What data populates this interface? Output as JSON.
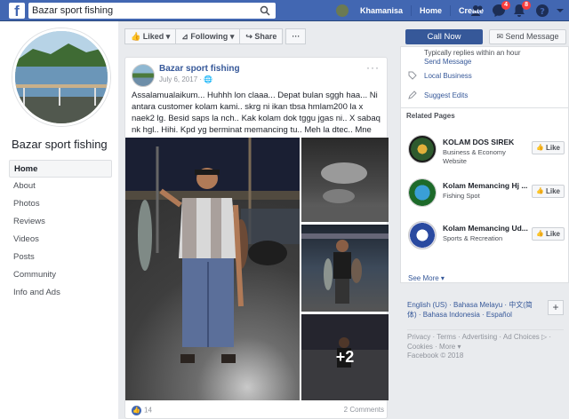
{
  "topbar": {
    "logo": "f",
    "search_value": "Bazar sport fishing",
    "user_name": "Khamanisa",
    "home_label": "Home",
    "create_label": "Create",
    "messages_badge": "4",
    "notifications_badge": "8"
  },
  "left": {
    "page_name": "Bazar sport fishing",
    "nav": [
      "Home",
      "About",
      "Photos",
      "Reviews",
      "Videos",
      "Posts",
      "Community",
      "Info and Ads"
    ]
  },
  "actions": {
    "liked": "Liked",
    "following": "Following",
    "share": "Share",
    "more": "···"
  },
  "post": {
    "page_name": "Bazar sport fishing",
    "date": "July 6, 2017 · 🌐",
    "text": "Assalamualaikum... Huhhh lon claaa... Depat bulan sggh haa... Ni antara customer kolam kami.. skrg ni ikan tbsa hmlam200 la x naek2 lg. Besid saps la nch.. Kak kolam dok tggu jgas ni.. X sabaq nk hgl.. Hihi. Kpd yg berminat memancing tu.. Meh la dtec.. Mne tau.. Ad rezki..",
    "more_photos": "+2",
    "likes": "14",
    "comments": "2 Comments"
  },
  "right": {
    "call_now": "Call Now",
    "send_message": "Send Message",
    "info_reply": "Typically replies within an hour",
    "info_send": "Send Message",
    "info_category": "Local Business",
    "info_suggest": "Suggest Edits",
    "related_title": "Related Pages",
    "related": [
      {
        "name": "KOLAM DOS SIREK",
        "sub": "Business & Economy Website",
        "like": "Like"
      },
      {
        "name": "Kolam Memancing Hj ...",
        "sub": "Fishing Spot",
        "like": "Like"
      },
      {
        "name": "Kolam Memancing Ud...",
        "sub": "Sports & Recreation",
        "like": "Like"
      }
    ],
    "see_more": "See More ▾",
    "languages": "English (US) · Bahasa Melayu · 中文(简体) · Bahasa Indonesia · Español",
    "lang_plus": "+",
    "footer_links": "Privacy · Terms · Advertising · Ad Choices ▷ · Cookies · More ▾",
    "copyright": "Facebook © 2018"
  }
}
